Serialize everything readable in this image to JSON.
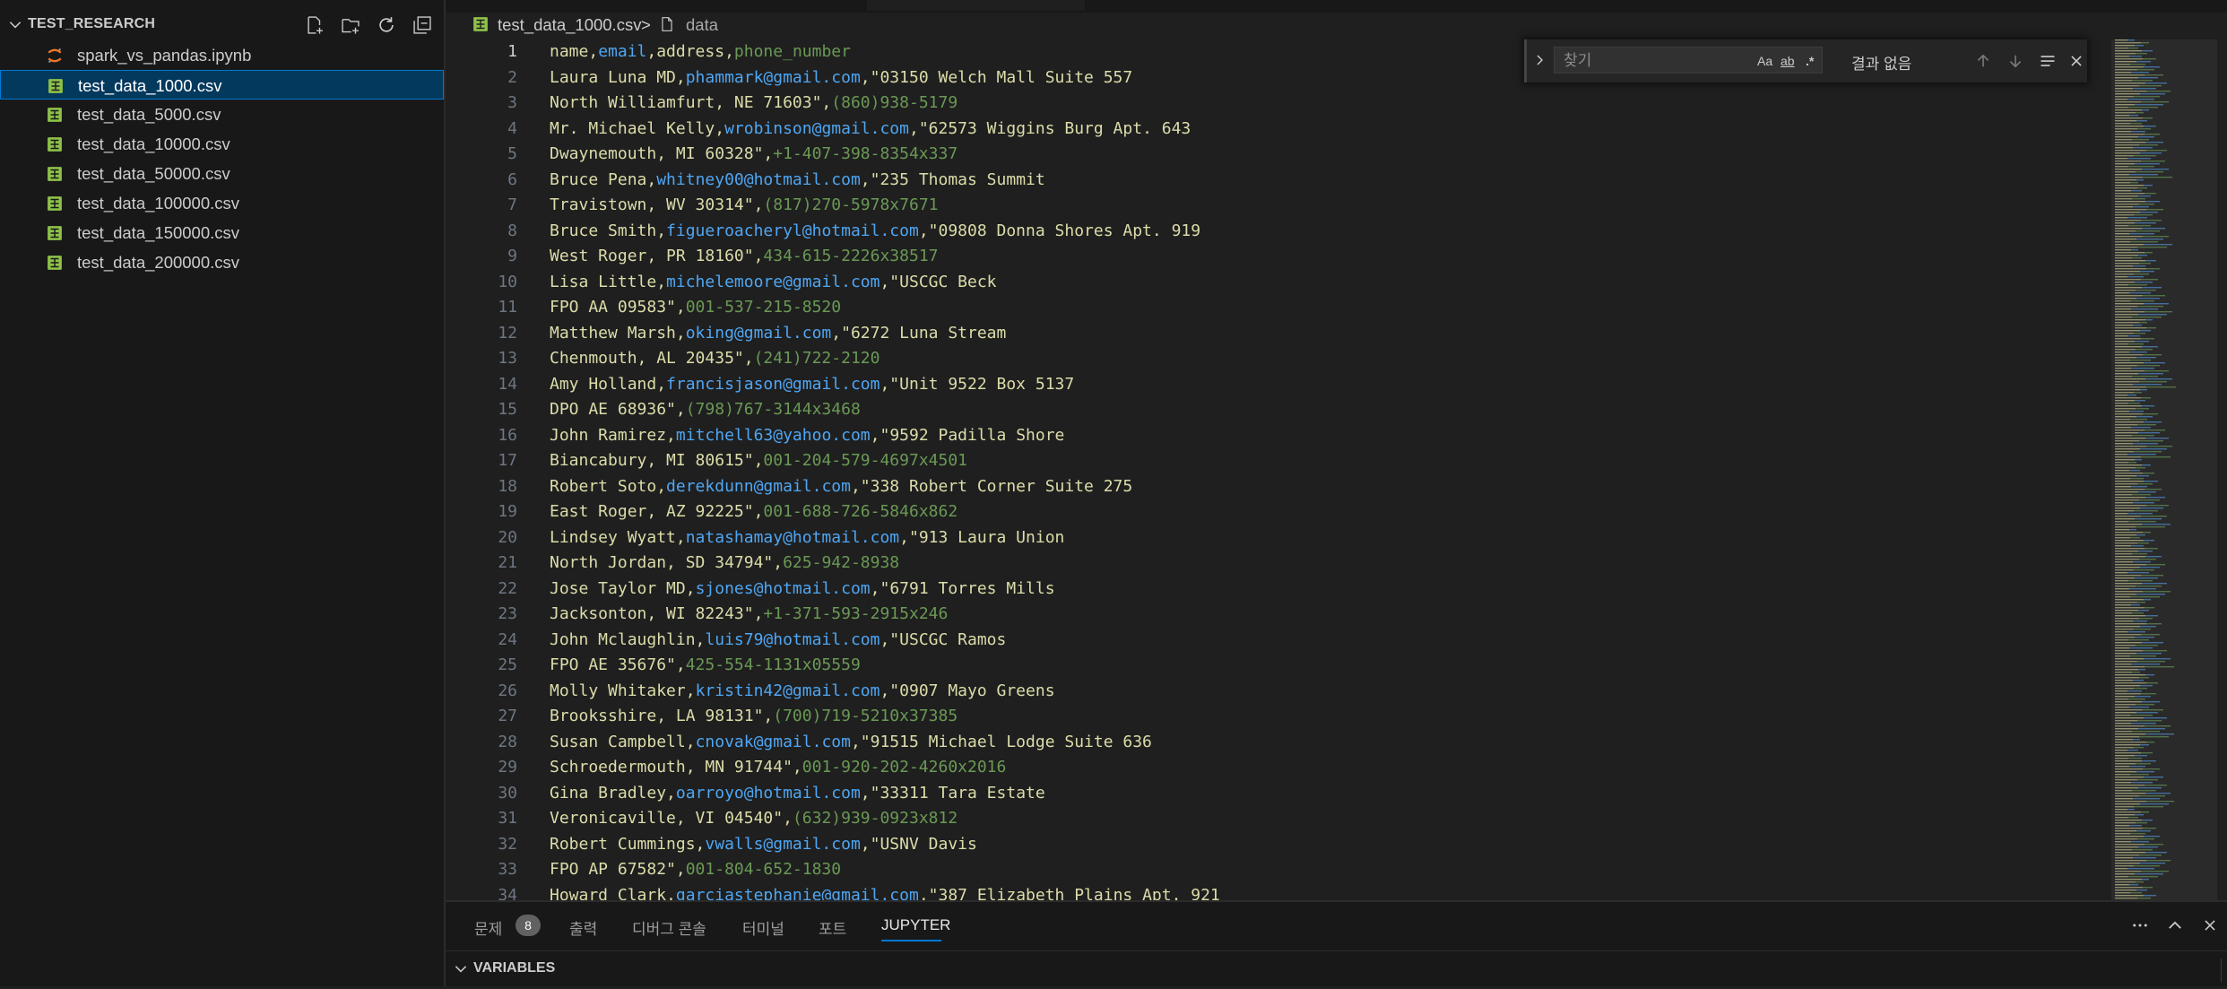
{
  "explorer": {
    "title": "TEST_RESEARCH",
    "files": [
      {
        "name": "spark_vs_pandas.ipynb",
        "type": "notebook"
      },
      {
        "name": "test_data_1000.csv",
        "type": "csv",
        "selected": true
      },
      {
        "name": "test_data_5000.csv",
        "type": "csv"
      },
      {
        "name": "test_data_10000.csv",
        "type": "csv"
      },
      {
        "name": "test_data_50000.csv",
        "type": "csv"
      },
      {
        "name": "test_data_100000.csv",
        "type": "csv"
      },
      {
        "name": "test_data_150000.csv",
        "type": "csv"
      },
      {
        "name": "test_data_200000.csv",
        "type": "csv"
      }
    ],
    "actions": [
      "new-file-icon",
      "new-folder-icon",
      "refresh-icon",
      "collapse-all-icon"
    ]
  },
  "breadcrumb": {
    "file": "test_data_1000.csv",
    "separator": ">",
    "symbol": "data"
  },
  "editor": {
    "active_line": 1,
    "lines": [
      [
        [
          "name,",
          "h"
        ],
        [
          "email",
          "e"
        ],
        [
          ",address,",
          "h"
        ],
        [
          "phone_number",
          "p"
        ]
      ],
      [
        [
          "Laura Luna MD,",
          "t"
        ],
        [
          "phammark@gmail.com",
          "e"
        ],
        [
          ",\"03150 Welch Mall Suite 557",
          "t"
        ]
      ],
      [
        [
          "North Williamfurt, NE 71603\",",
          "t"
        ],
        [
          "(860)938-5179",
          "p"
        ]
      ],
      [
        [
          "Mr. Michael Kelly,",
          "t"
        ],
        [
          "wrobinson@gmail.com",
          "e"
        ],
        [
          ",\"62573 Wiggins Burg Apt. 643",
          "t"
        ]
      ],
      [
        [
          "Dwaynemouth, MI 60328\",",
          "t"
        ],
        [
          "+1-407-398-8354x337",
          "p"
        ]
      ],
      [
        [
          "Bruce Pena,",
          "t"
        ],
        [
          "whitney00@hotmail.com",
          "e"
        ],
        [
          ",\"235 Thomas Summit",
          "t"
        ]
      ],
      [
        [
          "Travistown, WV 30314\",",
          "t"
        ],
        [
          "(817)270-5978x7671",
          "p"
        ]
      ],
      [
        [
          "Bruce Smith,",
          "t"
        ],
        [
          "figueroacheryl@hotmail.com",
          "e"
        ],
        [
          ",\"09808 Donna Shores Apt. 919",
          "t"
        ]
      ],
      [
        [
          "West Roger, PR 18160\",",
          "t"
        ],
        [
          "434-615-2226x38517",
          "p"
        ]
      ],
      [
        [
          "Lisa Little,",
          "t"
        ],
        [
          "michelemoore@gmail.com",
          "e"
        ],
        [
          ",\"USCGC Beck",
          "t"
        ]
      ],
      [
        [
          "FPO AA 09583\",",
          "t"
        ],
        [
          "001-537-215-8520",
          "p"
        ]
      ],
      [
        [
          "Matthew Marsh,",
          "t"
        ],
        [
          "oking@gmail.com",
          "e"
        ],
        [
          ",\"6272 Luna Stream",
          "t"
        ]
      ],
      [
        [
          "Chenmouth, AL 20435\",",
          "t"
        ],
        [
          "(241)722-2120",
          "p"
        ]
      ],
      [
        [
          "Amy Holland,",
          "t"
        ],
        [
          "francisjason@gmail.com",
          "e"
        ],
        [
          ",\"Unit 9522 Box 5137",
          "t"
        ]
      ],
      [
        [
          "DPO AE 68936\",",
          "t"
        ],
        [
          "(798)767-3144x3468",
          "p"
        ]
      ],
      [
        [
          "John Ramirez,",
          "t"
        ],
        [
          "mitchell63@yahoo.com",
          "e"
        ],
        [
          ",\"9592 Padilla Shore",
          "t"
        ]
      ],
      [
        [
          "Biancabury, MI 80615\",",
          "t"
        ],
        [
          "001-204-579-4697x4501",
          "p"
        ]
      ],
      [
        [
          "Robert Soto,",
          "t"
        ],
        [
          "derekdunn@gmail.com",
          "e"
        ],
        [
          ",\"338 Robert Corner Suite 275",
          "t"
        ]
      ],
      [
        [
          "East Roger, AZ 92225\",",
          "t"
        ],
        [
          "001-688-726-5846x862",
          "p"
        ]
      ],
      [
        [
          "Lindsey Wyatt,",
          "t"
        ],
        [
          "natashamay@hotmail.com",
          "e"
        ],
        [
          ",\"913 Laura Union",
          "t"
        ]
      ],
      [
        [
          "North Jordan, SD 34794\",",
          "t"
        ],
        [
          "625-942-8938",
          "p"
        ]
      ],
      [
        [
          "Jose Taylor MD,",
          "t"
        ],
        [
          "sjones@hotmail.com",
          "e"
        ],
        [
          ",\"6791 Torres Mills",
          "t"
        ]
      ],
      [
        [
          "Jacksonton, WI 82243\",",
          "t"
        ],
        [
          "+1-371-593-2915x246",
          "p"
        ]
      ],
      [
        [
          "John Mclaughlin,",
          "t"
        ],
        [
          "luis79@hotmail.com",
          "e"
        ],
        [
          ",\"USCGC Ramos",
          "t"
        ]
      ],
      [
        [
          "FPO AE 35676\",",
          "t"
        ],
        [
          "425-554-1131x05559",
          "p"
        ]
      ],
      [
        [
          "Molly Whitaker,",
          "t"
        ],
        [
          "kristin42@gmail.com",
          "e"
        ],
        [
          ",\"0907 Mayo Greens",
          "t"
        ]
      ],
      [
        [
          "Brooksshire, LA 98131\",",
          "t"
        ],
        [
          "(700)719-5210x37385",
          "p"
        ]
      ],
      [
        [
          "Susan Campbell,",
          "t"
        ],
        [
          "cnovak@gmail.com",
          "e"
        ],
        [
          ",\"91515 Michael Lodge Suite 636",
          "t"
        ]
      ],
      [
        [
          "Schroedermouth, MN 91744\",",
          "t"
        ],
        [
          "001-920-202-4260x2016",
          "p"
        ]
      ],
      [
        [
          "Gina Bradley,",
          "t"
        ],
        [
          "oarroyo@hotmail.com",
          "e"
        ],
        [
          ",\"33311 Tara Estate",
          "t"
        ]
      ],
      [
        [
          "Veronicaville, VI 04540\",",
          "t"
        ],
        [
          "(632)939-0923x812",
          "p"
        ]
      ],
      [
        [
          "Robert Cummings,",
          "t"
        ],
        [
          "vwalls@gmail.com",
          "e"
        ],
        [
          ",\"USNV Davis",
          "t"
        ]
      ],
      [
        [
          "FPO AP 67582\",",
          "t"
        ],
        [
          "001-804-652-1830",
          "p"
        ]
      ],
      [
        [
          "Howard Clark,",
          "t"
        ],
        [
          "garciastephanie@gmail.com",
          "e"
        ],
        [
          ",\"387 Elizabeth Plains Apt. 921",
          "t"
        ]
      ]
    ]
  },
  "find": {
    "placeholder": "찾기",
    "match_case": "Aa",
    "whole_word": "ab",
    "regex": ".*",
    "result": "결과 없음"
  },
  "panel": {
    "tabs": [
      {
        "label": "문제",
        "badge": "8"
      },
      {
        "label": "출력"
      },
      {
        "label": "디버그 콘솔"
      },
      {
        "label": "터미널"
      },
      {
        "label": "포트"
      },
      {
        "label": "JUPYTER",
        "active": true
      }
    ],
    "section": "VARIABLES"
  },
  "colors": {
    "text": "#dcdcaa",
    "email": "#4fa6f3",
    "phone": "#6a9955",
    "accent": "#0078d4"
  }
}
